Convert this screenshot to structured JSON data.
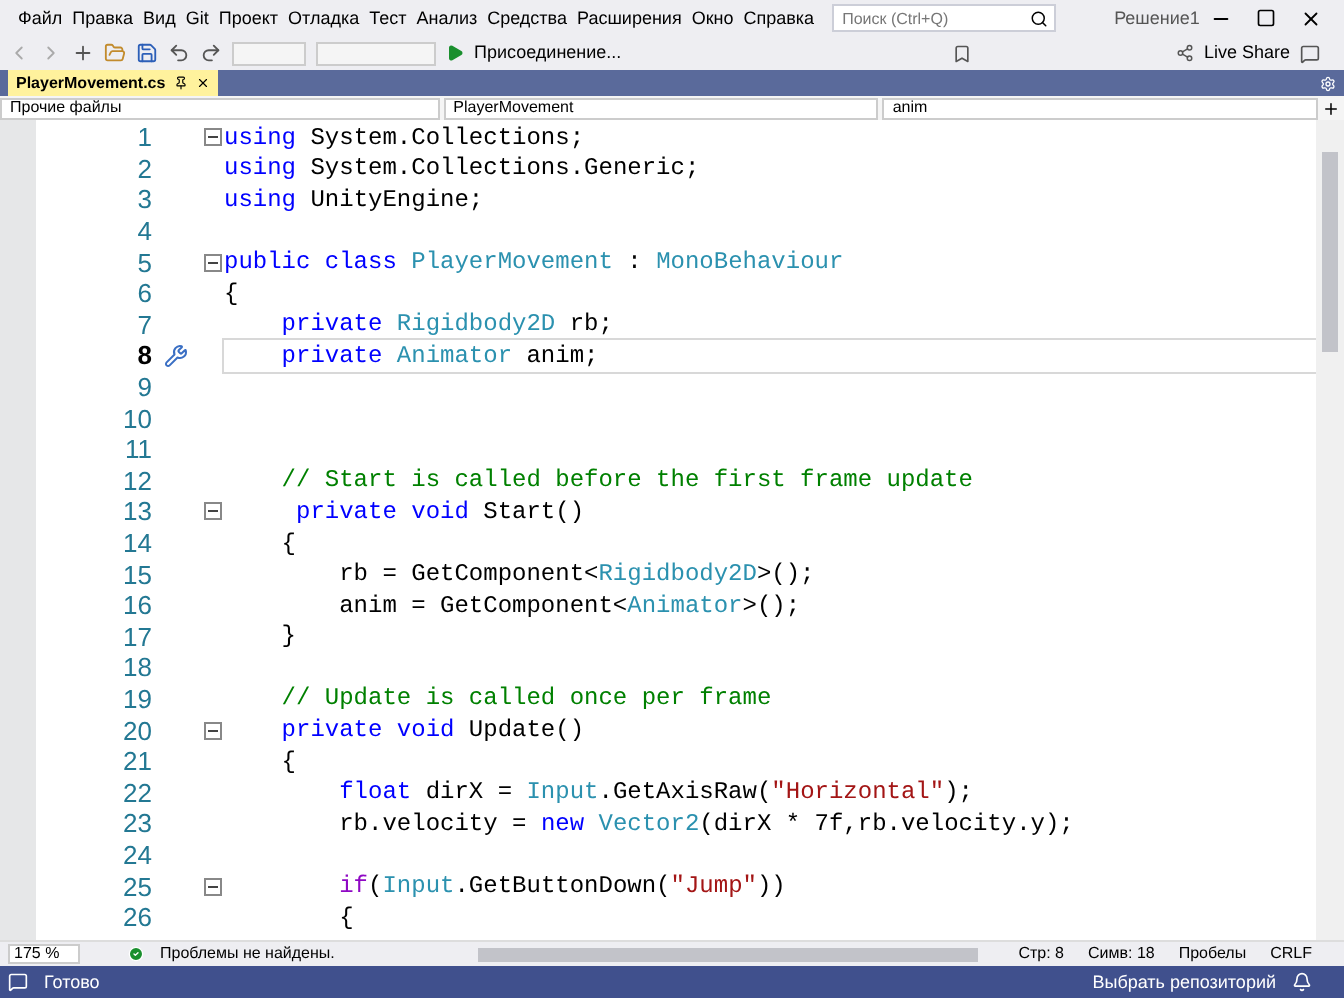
{
  "menu": {
    "items": [
      "Файл",
      "Правка",
      "Вид",
      "Git",
      "Проект",
      "Отладка",
      "Тест",
      "Анализ",
      "Средства",
      "Расширения",
      "Окно",
      "Справка"
    ],
    "search": {
      "placeholder": "Поиск (Ctrl+Q)"
    },
    "solution": "Решение1"
  },
  "toolbar": {
    "attach": "Присоединение...",
    "live_share": "Live Share"
  },
  "tab": {
    "title": "PlayerMovement.cs",
    "selected": true
  },
  "nav": [
    "Прочие файлы",
    "PlayerMovement",
    "anim"
  ],
  "lines": [
    {
      "number": "1",
      "fold": true,
      "current": false,
      "tokens": [
        {
          "kind": "kw",
          "text": "using"
        },
        {
          "kind": "plain",
          "text": " System.Collections;"
        }
      ]
    },
    {
      "number": "2",
      "fold": false,
      "current": false,
      "tokens": [
        {
          "kind": "kw",
          "text": "using"
        },
        {
          "kind": "plain",
          "text": " System.Collections.Generic;"
        }
      ]
    },
    {
      "number": "3",
      "fold": false,
      "current": false,
      "tokens": [
        {
          "kind": "kw",
          "text": "using"
        },
        {
          "kind": "plain",
          "text": " UnityEngine;"
        }
      ]
    },
    {
      "number": "4",
      "fold": false,
      "current": false
    },
    {
      "number": "5",
      "fold": true,
      "current": false,
      "tokens": [
        {
          "kind": "kw",
          "text": "public class"
        },
        {
          "kind": "type",
          "text": " PlayerMovement"
        },
        {
          "kind": "plain",
          "text": " : "
        },
        {
          "kind": "type",
          "text": "MonoBehaviour"
        }
      ]
    },
    {
      "number": "6",
      "fold": false,
      "current": false,
      "tokens": [
        {
          "kind": "plain",
          "text": "{"
        }
      ]
    },
    {
      "number": "7",
      "fold": false,
      "current": false,
      "tokens": [
        {
          "kind": "kw",
          "text": "    private"
        },
        {
          "kind": "type",
          "text": " Rigidbody2D"
        },
        {
          "kind": "plain",
          "text": " rb;"
        }
      ]
    },
    {
      "number": "8",
      "fold": false,
      "current": true,
      "tokens": [
        {
          "kind": "kw",
          "text": "    private"
        },
        {
          "kind": "type",
          "text": " Animator"
        },
        {
          "kind": "plain",
          "text": " anim;"
        }
      ]
    },
    {
      "number": "9",
      "fold": false,
      "current": false
    },
    {
      "number": "10",
      "fold": false,
      "current": false
    },
    {
      "number": "11",
      "fold": false,
      "current": false
    },
    {
      "number": "12",
      "fold": false,
      "current": false,
      "tokens": [
        {
          "kind": "comment",
          "text": "    // Start is called before the first frame update"
        }
      ]
    },
    {
      "number": "13",
      "fold": true,
      "current": false,
      "tokens": [
        {
          "kind": "kw",
          "text": "     private void"
        },
        {
          "kind": "plain",
          "text": " Start()"
        }
      ]
    },
    {
      "number": "14",
      "fold": false,
      "current": false,
      "tokens": [
        {
          "kind": "plain",
          "text": "    {"
        }
      ]
    },
    {
      "number": "15",
      "fold": false,
      "current": false,
      "tokens": [
        {
          "kind": "plain",
          "text": "        rb = GetComponent<"
        },
        {
          "kind": "type",
          "text": "Rigidbody2D"
        },
        {
          "kind": "plain",
          "text": ">();"
        }
      ]
    },
    {
      "number": "16",
      "fold": false,
      "current": false,
      "tokens": [
        {
          "kind": "plain",
          "text": "        anim = GetComponent<"
        },
        {
          "kind": "type",
          "text": "Animator"
        },
        {
          "kind": "plain",
          "text": ">();"
        }
      ]
    },
    {
      "number": "17",
      "fold": false,
      "current": false,
      "tokens": [
        {
          "kind": "plain",
          "text": "    }"
        }
      ]
    },
    {
      "number": "18",
      "fold": false,
      "current": false
    },
    {
      "number": "19",
      "fold": false,
      "current": false,
      "tokens": [
        {
          "kind": "comment",
          "text": "    // Update is called once per frame"
        }
      ]
    },
    {
      "number": "20",
      "fold": true,
      "current": false,
      "tokens": [
        {
          "kind": "kw",
          "text": "    private void"
        },
        {
          "kind": "plain",
          "text": " Update()"
        }
      ]
    },
    {
      "number": "21",
      "fold": false,
      "current": false,
      "tokens": [
        {
          "kind": "plain",
          "text": "    {"
        }
      ]
    },
    {
      "number": "22",
      "fold": false,
      "current": false,
      "tokens": [
        {
          "kind": "kw",
          "text": "        float"
        },
        {
          "kind": "plain",
          "text": " dirX = "
        },
        {
          "kind": "type",
          "text": "Input"
        },
        {
          "kind": "plain",
          "text": ".GetAxisRaw("
        },
        {
          "kind": "string",
          "text": "\"Horizontal\""
        },
        {
          "kind": "plain",
          "text": ");"
        }
      ]
    },
    {
      "number": "23",
      "fold": false,
      "current": false,
      "tokens": [
        {
          "kind": "plain",
          "text": "        rb.velocity = "
        },
        {
          "kind": "kw",
          "text": "new"
        },
        {
          "kind": "type",
          "text": " Vector2"
        },
        {
          "kind": "plain",
          "text": "(dirX * 7f,rb.velocity.y);"
        }
      ]
    },
    {
      "number": "24",
      "fold": false,
      "current": false
    },
    {
      "number": "25",
      "fold": true,
      "current": false,
      "tokens": [
        {
          "kind": "control",
          "text": "        if"
        },
        {
          "kind": "plain",
          "text": "("
        },
        {
          "kind": "type",
          "text": "Input"
        },
        {
          "kind": "plain",
          "text": ".GetButtonDown("
        },
        {
          "kind": "string",
          "text": "\"Jump\""
        },
        {
          "kind": "plain",
          "text": "))"
        }
      ]
    },
    {
      "number": "26",
      "fold": false,
      "current": false,
      "tokens": [
        {
          "kind": "plain",
          "text": "        {"
        }
      ]
    }
  ],
  "editor_status": {
    "zoom": "175 %",
    "issues": "Проблемы не найдены.",
    "fields": [
      "Стр: 8",
      "Симв: 18",
      "Пробелы",
      "CRLF"
    ]
  },
  "status_bar": {
    "message": "Готово",
    "repository": "Выбрать репозиторий"
  }
}
